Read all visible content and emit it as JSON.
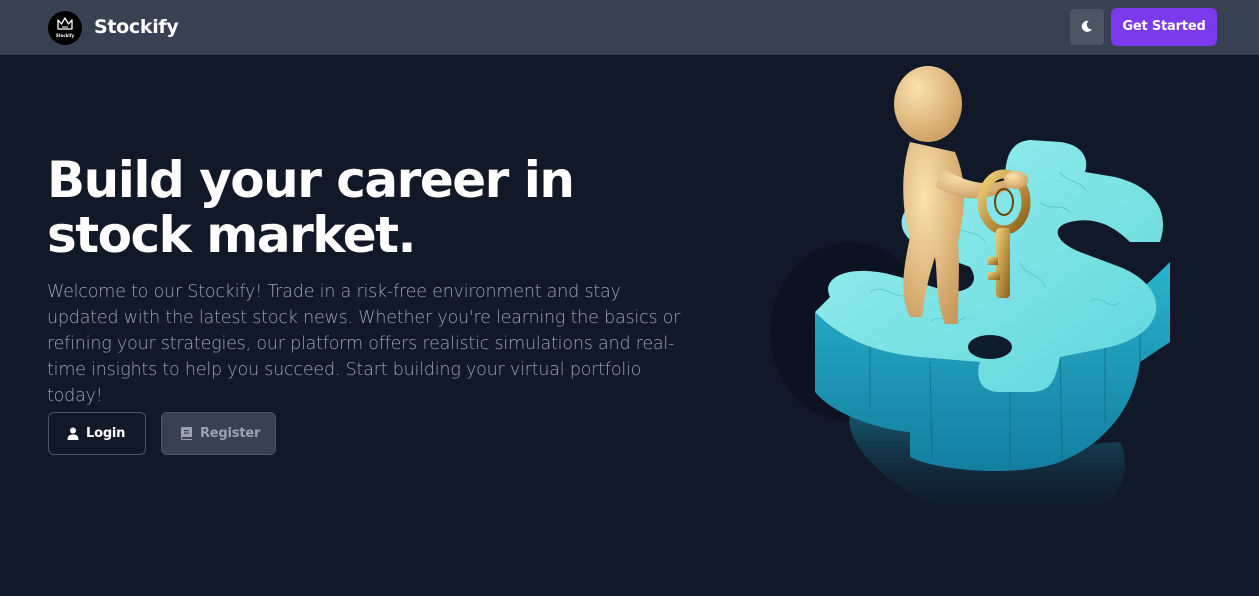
{
  "navbar": {
    "logo_text": "Stockify",
    "brand": "Stockify",
    "theme_toggle_icon": "moon-icon",
    "cta_label": "Get Started"
  },
  "hero": {
    "title_line1": "Build your career in",
    "title_line2": "stock market.",
    "description": "Welcome to our Stockify! Trade in a risk-free environment and stay updated with the latest stock news. Whether you're learning the basics or refining your strategies, our platform offers realistic simulations and real-time insights to help you succeed. Start building your virtual portfolio today!",
    "login_label": "Login",
    "login_icon": "user-icon",
    "register_label": "Register",
    "register_icon": "book-icon"
  },
  "colors": {
    "background": "#111827",
    "navbar": "#374151",
    "accent": "#7c3aed",
    "muted_text": "#9ca3af"
  }
}
